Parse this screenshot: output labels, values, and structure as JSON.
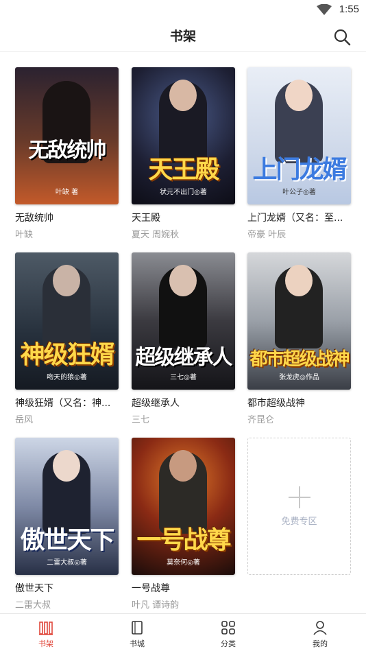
{
  "status": {
    "time": "1:55"
  },
  "header": {
    "title": "书架"
  },
  "books": [
    {
      "name": "无敌统帅",
      "author": "叶缺",
      "cover_text": "无敌统帅",
      "cover_author": "叶缺 著"
    },
    {
      "name": "天王殿",
      "author": "夏天  周婉秋",
      "cover_text": "天王殿",
      "cover_author": "状元不出门◎著"
    },
    {
      "name": "上门龙婿（又名：至...",
      "author": "帝豪  叶辰",
      "cover_text": "上门龙婿",
      "cover_author": "叶公子◎著"
    },
    {
      "name": "神级狂婿（又名：神...",
      "author": "岳风",
      "cover_text": "神级狂婿",
      "cover_author": "吻天的狼◎著"
    },
    {
      "name": "超级继承人",
      "author": "三七",
      "cover_text": "超级继承人",
      "cover_author": "三七◎著"
    },
    {
      "name": "都市超级战神",
      "author": "齐昆仑",
      "cover_text": "都市超级战神",
      "cover_author": "张龙虎◎作品"
    },
    {
      "name": "傲世天下",
      "author": "二雷大叔",
      "cover_text": "傲世天下",
      "cover_author": "二雷大叔◎著"
    },
    {
      "name": "一号战尊",
      "author": "叶凡  谭诗韵",
      "cover_text": "一号战尊",
      "cover_author": "莫奈何◎著"
    }
  ],
  "free_zone": {
    "label": "免费专区"
  },
  "tabbar": {
    "items": [
      {
        "label": "书架",
        "icon": "bookshelf-icon",
        "active": true
      },
      {
        "label": "书城",
        "icon": "book-icon",
        "active": false
      },
      {
        "label": "分类",
        "icon": "grid-icon",
        "active": false
      },
      {
        "label": "我的",
        "icon": "user-icon",
        "active": false
      }
    ]
  },
  "colors": {
    "accent": "#e0483c",
    "muted": "#999999",
    "free_label": "#aab2c4"
  }
}
